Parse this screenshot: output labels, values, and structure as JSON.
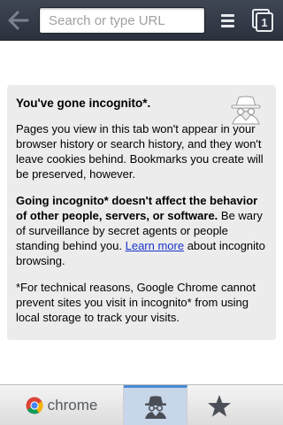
{
  "toolbar": {
    "back_icon": "arrow-left-icon",
    "search_placeholder": "Search or type URL",
    "menu_icon": "menu-icon",
    "tab_count": "1"
  },
  "card": {
    "title": "You've gone incognito*.",
    "para1": "Pages you view in this tab won't appear in your browser history or search history, and they won't leave cookies behind. Bookmarks you create will be preserved, however.",
    "para2_bold": "Going incognito* doesn't affect the behavior of other people, servers, or software.",
    "para2_rest": " Be wary of surveillance by secret agents or people standing behind you. ",
    "learn_more": "Learn more",
    "para2_end": " about incognito browsing.",
    "para3": "*For technical reasons, Google Chrome cannot prevent sites you visit in incognito* from using local storage to track your visits.",
    "icon": "incognito-spy-icon"
  },
  "bottombar": {
    "chrome_label": "chrome",
    "incognito_icon": "incognito-icon",
    "bookmarks_icon": "star-icon"
  },
  "colors": {
    "toolbar_bg": "#353b48",
    "card_bg": "#ececec",
    "link": "#1a33cc",
    "active_tab_bg": "#c8d6ea",
    "active_tab_accent": "#4a8ad6"
  }
}
